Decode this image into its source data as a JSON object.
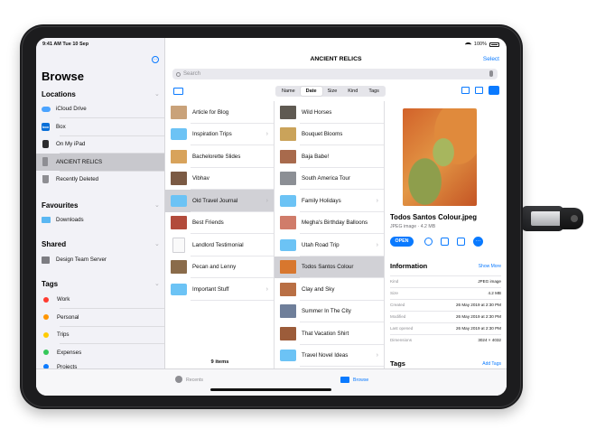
{
  "status": {
    "time": "9:41 AM",
    "date": "Tue 10 Sep",
    "battery": "100%"
  },
  "sidebar": {
    "title": "Browse",
    "sections": {
      "locations": "Locations",
      "favourites": "Favourites",
      "shared": "Shared",
      "tags": "Tags"
    },
    "locations": [
      {
        "label": "iCloud Drive",
        "icon": "cloud-icon"
      },
      {
        "label": "Box",
        "icon": "box-icon",
        "badge": "box"
      },
      {
        "label": "On My iPad",
        "icon": "ipad-icon"
      },
      {
        "label": "ANCIENT RELICS",
        "icon": "usb-drive-icon",
        "selected": true
      },
      {
        "label": "Recently Deleted",
        "icon": "trash-icon"
      }
    ],
    "favourites": [
      {
        "label": "Downloads",
        "icon": "folder-icon"
      }
    ],
    "shared": [
      {
        "label": "Design Team Server",
        "icon": "server-icon"
      }
    ],
    "tags": [
      {
        "label": "Work",
        "color": "#ff3b30"
      },
      {
        "label": "Personal",
        "color": "#ff9500"
      },
      {
        "label": "Trips",
        "color": "#ffcc00"
      },
      {
        "label": "Expenses",
        "color": "#34c759"
      },
      {
        "label": "Projects",
        "color": "#0a7aff"
      }
    ]
  },
  "header": {
    "title": "ANCIENT RELICS",
    "select_label": "Select",
    "search_placeholder": "Search",
    "sort": [
      "Name",
      "Date",
      "Size",
      "Kind",
      "Tags"
    ],
    "sort_active": "Date"
  },
  "column1": {
    "items": [
      {
        "label": "Article for Blog",
        "kind": "image",
        "color": "#c9a27a"
      },
      {
        "label": "Inspiration Trips",
        "kind": "folder",
        "chevron": true
      },
      {
        "label": "Bachelorette Slides",
        "kind": "image",
        "color": "#d8a35b"
      },
      {
        "label": "Vibhav",
        "kind": "image",
        "color": "#7b5a44"
      },
      {
        "label": "Old Travel Journal",
        "kind": "folder",
        "chevron": true,
        "selected": true
      },
      {
        "label": "Best Friends",
        "kind": "image",
        "color": "#b24b3b"
      },
      {
        "label": "Landlord Testimonial",
        "kind": "doc"
      },
      {
        "label": "Pecan and Lenny",
        "kind": "image",
        "color": "#8a6b4a"
      },
      {
        "label": "Important Stuff",
        "kind": "folder",
        "chevron": true
      }
    ],
    "count": "9 items"
  },
  "column2": {
    "items": [
      {
        "label": "Wild Horses",
        "kind": "image",
        "color": "#5f5a52"
      },
      {
        "label": "Bouquet Blooms",
        "kind": "image",
        "color": "#caa35a"
      },
      {
        "label": "Baja Babe!",
        "kind": "image",
        "color": "#a86a4c"
      },
      {
        "label": "South America Tour",
        "kind": "image",
        "color": "#8c8f95"
      },
      {
        "label": "Family Holidays",
        "kind": "folder",
        "chevron": true
      },
      {
        "label": "Megha's Birthday Balloons",
        "kind": "image",
        "color": "#d07c6a"
      },
      {
        "label": "Utah Road Trip",
        "kind": "folder",
        "chevron": true
      },
      {
        "label": "Todos Santos Colour",
        "kind": "image",
        "color": "#d8772e",
        "selected": true
      },
      {
        "label": "Clay and Sky",
        "kind": "image",
        "color": "#b96f44"
      },
      {
        "label": "Summer In The City",
        "kind": "image",
        "color": "#6f7f9a"
      },
      {
        "label": "That Vacation Shirt",
        "kind": "image",
        "color": "#9c5c3a"
      },
      {
        "label": "Travel Novel Ideas",
        "kind": "folder",
        "chevron": true
      }
    ]
  },
  "preview": {
    "file_name": "Todos Santos Colour.jpeg",
    "file_sub": "JPEG image · 4.2 MB",
    "open_label": "OPEN",
    "info_title": "Information",
    "show_more": "Show More",
    "info": [
      {
        "key": "Kind",
        "value": "JPEG image"
      },
      {
        "key": "Size",
        "value": "4.2 MB"
      },
      {
        "key": "Created",
        "value": "26 May 2019 at 2:30 PM"
      },
      {
        "key": "Modified",
        "value": "26 May 2019 at 2:30 PM"
      },
      {
        "key": "Last opened",
        "value": "26 May 2019 at 2:30 PM"
      },
      {
        "key": "Dimensions",
        "value": "3024 × 4032"
      }
    ],
    "tags_title": "Tags",
    "add_tags": "Add Tags"
  },
  "tabbar": {
    "recents": "Recents",
    "browse": "Browse"
  }
}
